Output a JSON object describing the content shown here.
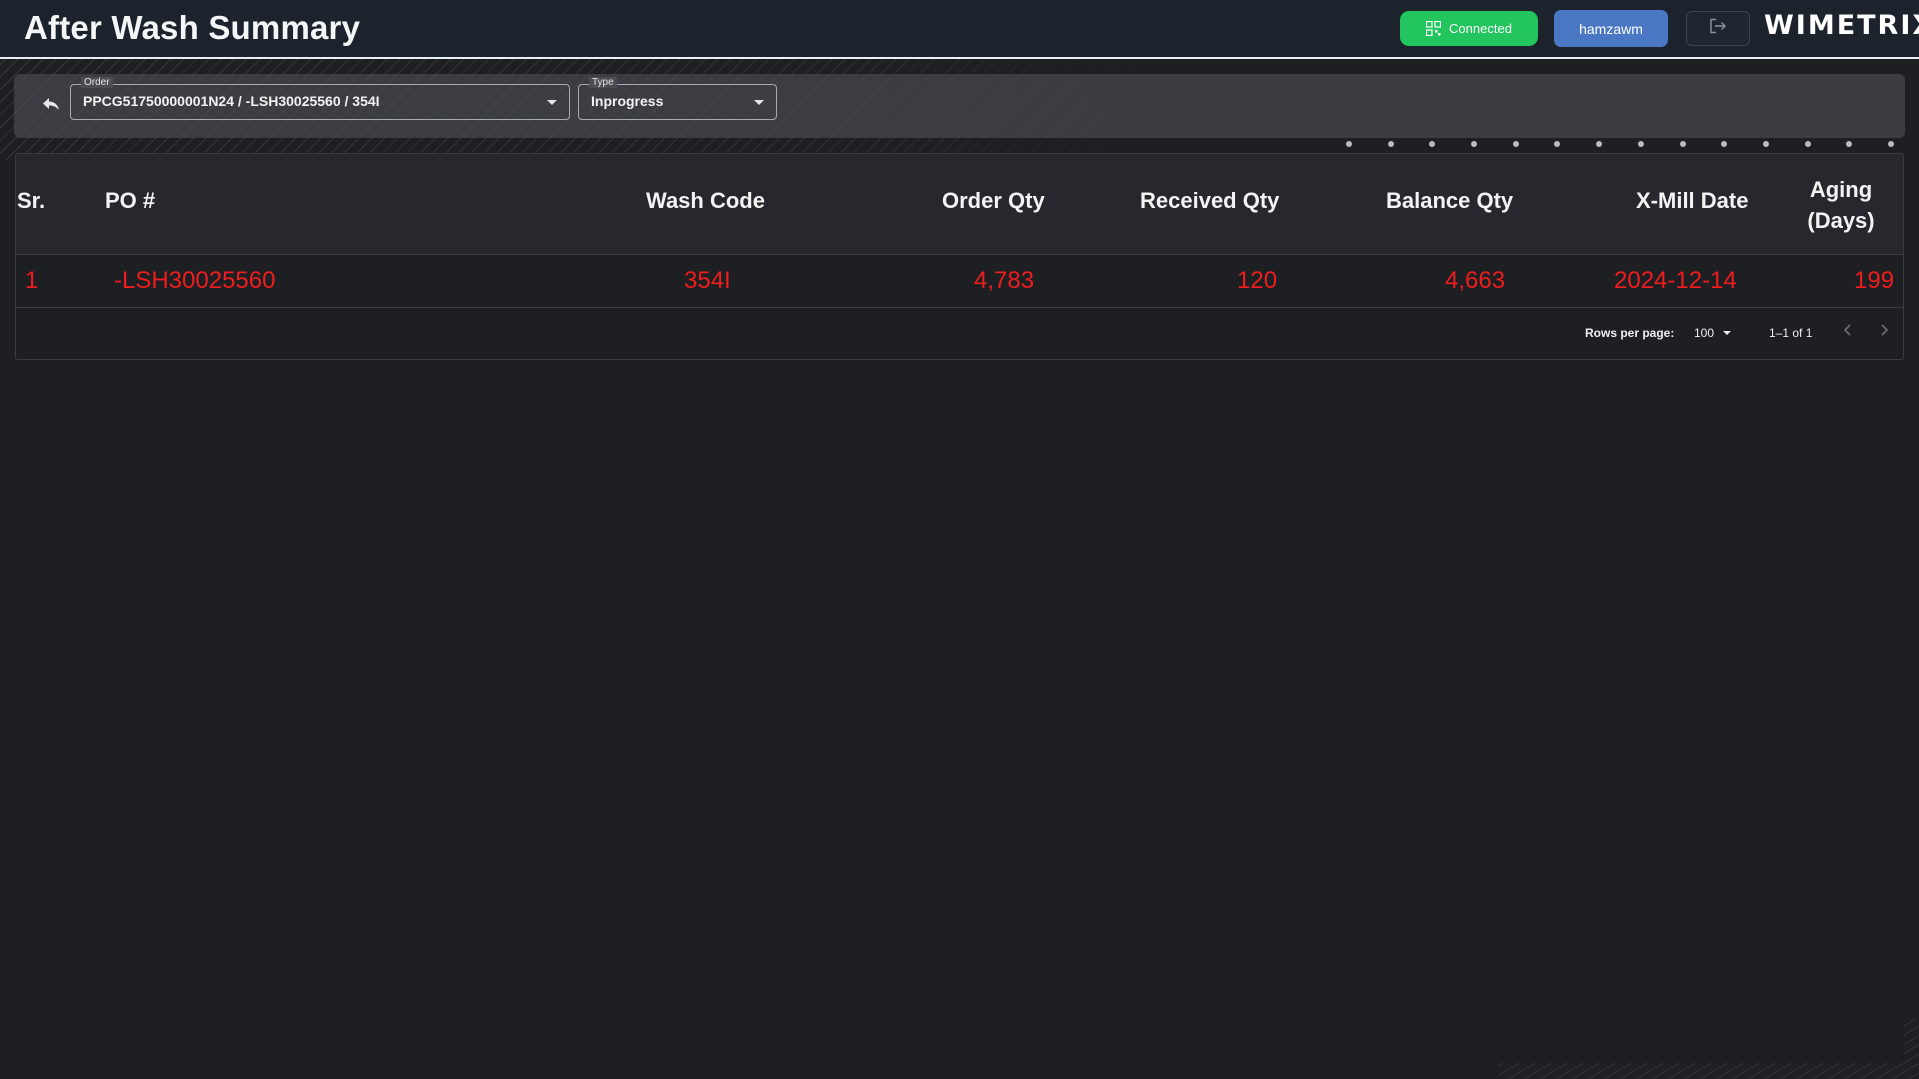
{
  "header": {
    "title": "After Wash Summary",
    "status_label": "Connected",
    "user_label": "hamzawm",
    "logo_text": "WIMETRIX"
  },
  "filters": {
    "order": {
      "legend": "Order",
      "value": "PPCG51750000001N24 / -LSH30025560 / 354I"
    },
    "type": {
      "legend": "Type",
      "value": "Inprogress"
    }
  },
  "table": {
    "columns": {
      "sr": "Sr.",
      "po": "PO #",
      "wash_code": "Wash Code",
      "order_qty": "Order Qty",
      "received_qty": "Received Qty",
      "balance_qty": "Balance Qty",
      "xmill_date": "X-Mill Date",
      "aging_line1": "Aging",
      "aging_line2": "(Days)"
    },
    "rows": [
      {
        "sr": "1",
        "po": "-LSH30025560",
        "wash_code": "354I",
        "order_qty": "4,783",
        "received_qty": "120",
        "balance_qty": "4,663",
        "xmill_date": "2024-12-14",
        "aging": "199"
      }
    ],
    "row_text_color": "#ef1d1d"
  },
  "pagination": {
    "rows_per_page_label": "Rows per page:",
    "rows_per_page_value": "100",
    "range_label": "1–1 of 1"
  },
  "colors": {
    "accent_status": "#22c55e",
    "accent_user": "#4a78c4"
  },
  "icons": {
    "status": "qr-code-icon",
    "back": "back-arrow-icon",
    "logout": "logout-icon",
    "prev": "chevron-left-icon",
    "next": "chevron-right-icon"
  }
}
